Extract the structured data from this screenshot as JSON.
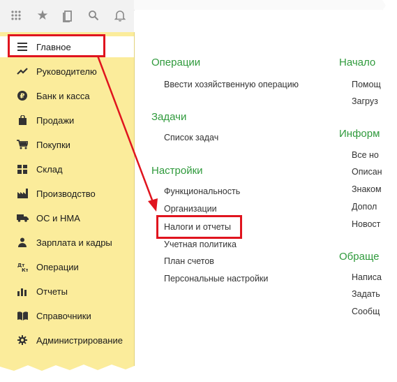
{
  "toolbar": {
    "icons": [
      "apps-grid-icon",
      "star-icon",
      "history-icon",
      "search-icon",
      "bell-icon"
    ]
  },
  "sidebar": {
    "items": [
      {
        "label": "Главное",
        "icon": "menu-icon"
      },
      {
        "label": "Руководителю",
        "icon": "trend-icon"
      },
      {
        "label": "Банк и касса",
        "icon": "ruble-icon"
      },
      {
        "label": "Продажи",
        "icon": "bag-icon"
      },
      {
        "label": "Покупки",
        "icon": "cart-icon"
      },
      {
        "label": "Склад",
        "icon": "warehouse-icon"
      },
      {
        "label": "Производство",
        "icon": "factory-icon"
      },
      {
        "label": "ОС и НМА",
        "icon": "truck-icon"
      },
      {
        "label": "Зарплата и кадры",
        "icon": "people-icon"
      },
      {
        "label": "Операции",
        "icon": "dt-kt-icon"
      },
      {
        "label": "Отчеты",
        "icon": "bar-chart-icon"
      },
      {
        "label": "Справочники",
        "icon": "book-icon"
      },
      {
        "label": "Администрирование",
        "icon": "gear-icon"
      }
    ]
  },
  "main": {
    "col1": {
      "sections": [
        {
          "title": "Операции",
          "links": [
            "Ввести хозяйственную операцию"
          ]
        },
        {
          "title": "Задачи",
          "links": [
            "Список задач"
          ]
        },
        {
          "title": "Настройки",
          "links": [
            "Функциональность",
            "Организации",
            "Налоги и отчеты",
            "Учетная политика",
            "План счетов",
            "Персональные настройки"
          ]
        }
      ]
    },
    "col2": {
      "sections": [
        {
          "title": "Начало",
          "links": [
            "Помощ",
            "Загруз"
          ]
        },
        {
          "title": "Информ",
          "links": [
            "Все но",
            "Описан",
            "Знаком",
            "Допол",
            "Новост"
          ]
        },
        {
          "title": "Обраще",
          "links": [
            "Написа",
            "Задать",
            "Сообщ"
          ]
        }
      ]
    }
  },
  "colors": {
    "sidebar_bg": "#fbec9b",
    "section_title": "#2f9a3c",
    "highlight": "#e0141e"
  }
}
